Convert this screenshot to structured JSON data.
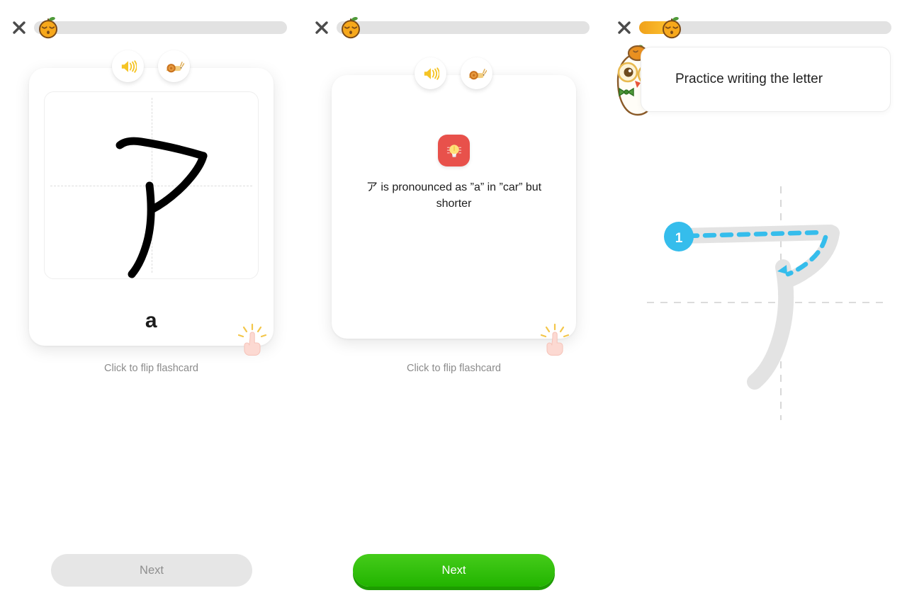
{
  "app": {
    "close_label": "✕",
    "mascot_name": "orange-character"
  },
  "panels": [
    {
      "id": "panel-flashcard-front",
      "progress_percent": 0,
      "audio": {
        "play_label": "speaker-icon",
        "slow_label": "snail-icon"
      },
      "card": {
        "side": "front",
        "character": "ア",
        "romaji": "a",
        "flip_hint": "Click to flip flashcard"
      },
      "next_button": {
        "label": "Next",
        "state": "disabled"
      }
    },
    {
      "id": "panel-flashcard-back",
      "progress_percent": 0,
      "audio": {
        "play_label": "speaker-icon",
        "slow_label": "snail-icon"
      },
      "card": {
        "side": "back",
        "tip_icon": "lightbulb-icon",
        "tip_text": "ア is pronounced as ”a” in ”car” but shorter",
        "flip_hint": "Click to flip flashcard"
      },
      "next_button": {
        "label": "Next",
        "state": "active"
      }
    },
    {
      "id": "panel-writing-practice",
      "progress_percent": 13,
      "instruction": "Practice writing the letter",
      "teacher_icon": "teacher-mascot-icon",
      "stroke_guide": {
        "character": "ア",
        "stroke_number": "1",
        "total_strokes": 1,
        "guide_color": "#e3e3e3",
        "path_color": "#35bdec"
      }
    }
  ],
  "colors": {
    "progress_track": "#e2e2e2",
    "progress_fill_start": "#f0a11b",
    "progress_fill_end": "#fdc330",
    "next_active": "#45cc1a",
    "next_active_shadow": "#1d9c00",
    "next_disabled": "#e6e6e6",
    "tip_badge": "#e8514b",
    "stroke_accent": "#35bdec",
    "stroke_guide_gray": "#e3e3e3",
    "text_primary": "#1c1c1c",
    "text_muted": "#8b8b8b"
  }
}
